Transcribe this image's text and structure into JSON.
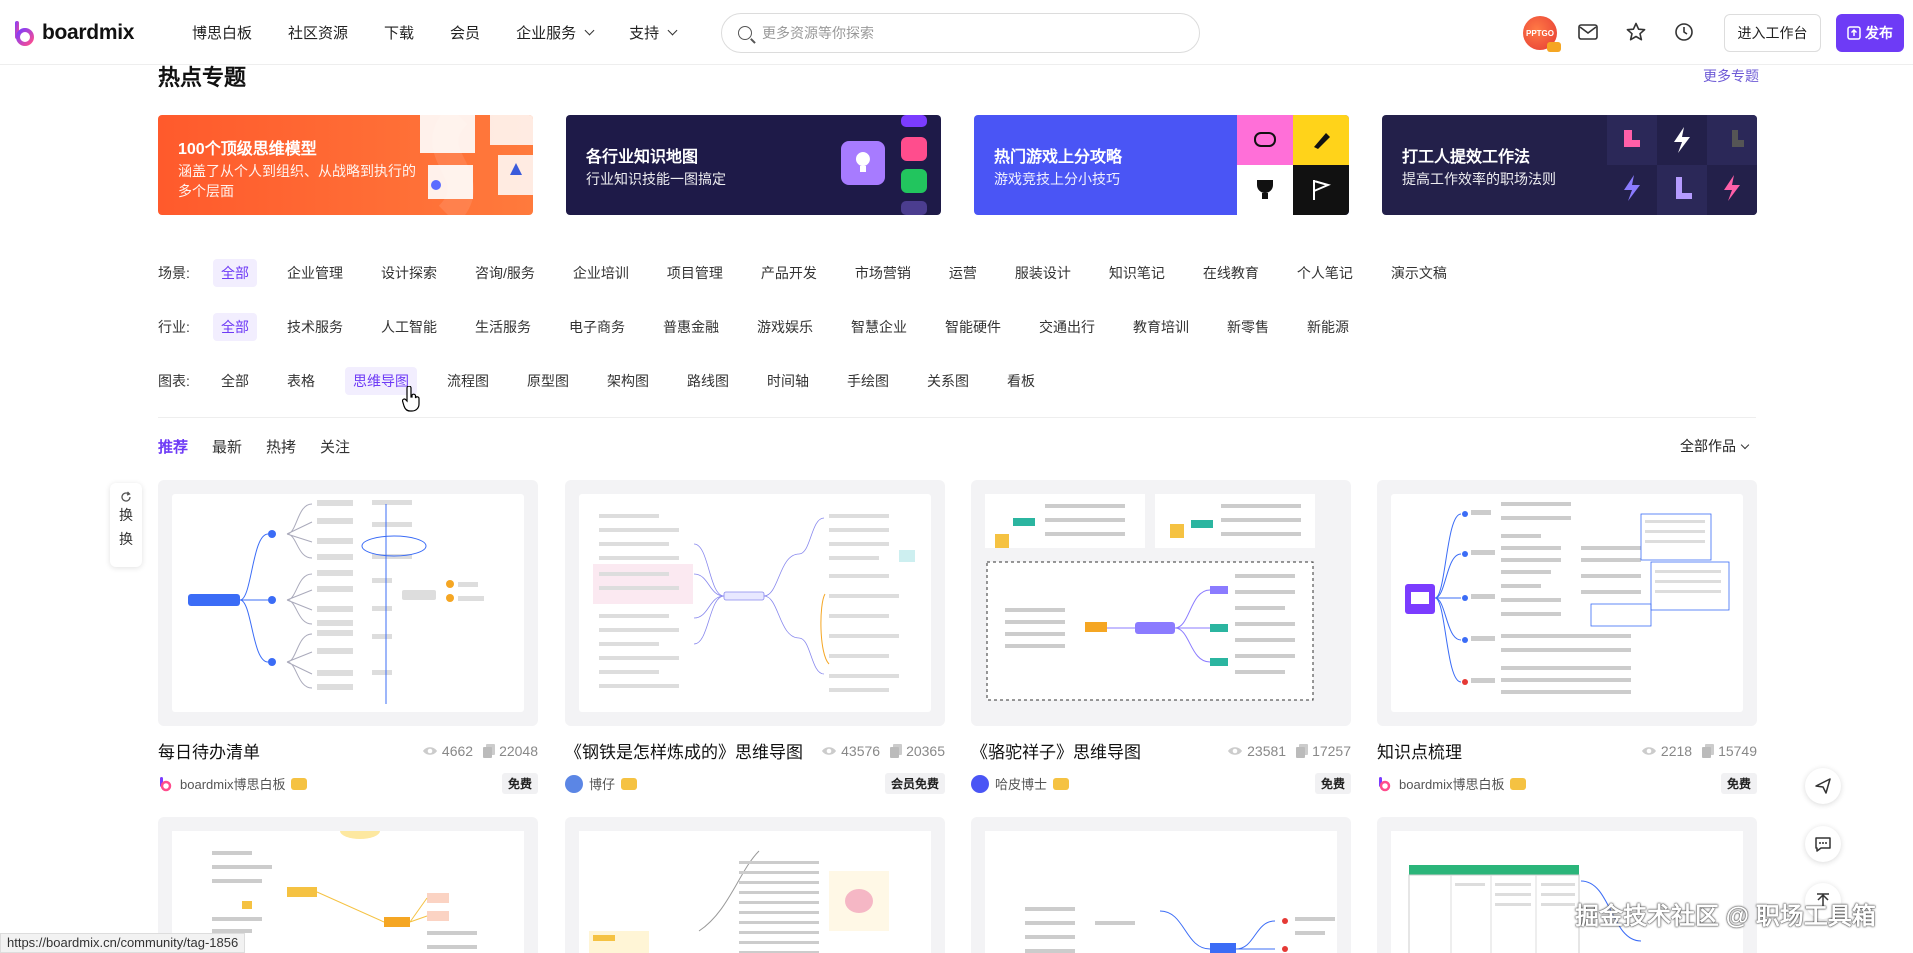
{
  "brand": {
    "name": "boardmix"
  },
  "nav": {
    "items": [
      {
        "label": "博思白板"
      },
      {
        "label": "社区资源"
      },
      {
        "label": "下载"
      },
      {
        "label": "会员"
      },
      {
        "label": "企业服务"
      },
      {
        "label": "支持"
      }
    ],
    "search_placeholder": "更多资源等你探索",
    "avatar_text": "PPTGO",
    "workspace_label": "进入工作台",
    "publish_label": "发布"
  },
  "topics": {
    "title": "热点专题",
    "more_label": "更多专题",
    "banners": [
      {
        "title": "100个顶级思维模型",
        "subtitle": "涵盖了从个人到组织、从战略到执行的多个层面"
      },
      {
        "title": "各行业知识地图",
        "subtitle": "行业知识技能一图搞定"
      },
      {
        "title": "热门游戏上分攻略",
        "subtitle": "游戏竞技上分小技巧"
      },
      {
        "title": "打工人提效工作法",
        "subtitle": "提高工作效率的职场法则"
      }
    ]
  },
  "filters": {
    "scene": {
      "label": "场景:",
      "items": [
        "全部",
        "企业管理",
        "设计探索",
        "咨询/服务",
        "企业培训",
        "项目管理",
        "产品开发",
        "市场营销",
        "运营",
        "服装设计",
        "知识笔记",
        "在线教育",
        "个人笔记",
        "演示文稿"
      ],
      "active": "全部"
    },
    "industry": {
      "label": "行业:",
      "items": [
        "全部",
        "技术服务",
        "人工智能",
        "生活服务",
        "电子商务",
        "普惠金融",
        "游戏娱乐",
        "智慧企业",
        "智能硬件",
        "交通出行",
        "教育培训",
        "新零售",
        "新能源"
      ],
      "active": "全部"
    },
    "chart": {
      "label": "图表:",
      "items": [
        "全部",
        "表格",
        "思维导图",
        "流程图",
        "原型图",
        "架构图",
        "路线图",
        "时间轴",
        "手绘图",
        "关系图",
        "看板"
      ],
      "active": "思维导图"
    }
  },
  "tabs": {
    "items": [
      "推荐",
      "最新",
      "热拷",
      "关注"
    ],
    "active": "推荐",
    "all_works_label": "全部作品"
  },
  "refresh": {
    "chars": [
      "换",
      "换"
    ]
  },
  "cards": [
    {
      "title": "每日待办清单",
      "views": "4662",
      "copies": "22048",
      "author": "boardmix博思白板",
      "price": "免费",
      "author_color": "#6e3bf6"
    },
    {
      "title": "《钢铁是怎样炼成的》思维导图",
      "views": "43576",
      "copies": "20365",
      "author": "博仔",
      "price": "会员免费",
      "author_color": "#3b6cf6"
    },
    {
      "title": "《骆驼祥子》思维导图",
      "views": "23581",
      "copies": "17257",
      "author": "哈皮博士",
      "price": "免费",
      "author_color": "#4a55f5"
    },
    {
      "title": "知识点梳理",
      "views": "2218",
      "copies": "15749",
      "author": "boardmix博思白板",
      "price": "免费",
      "author_color": "#6e3bf6"
    }
  ],
  "status_url": "https://boardmix.cn/community/tag-1856",
  "watermark": "掘金技术社区 @ 职场工具箱",
  "colors": {
    "accent": "#6e3bf6",
    "link": "#6e5bd6"
  }
}
